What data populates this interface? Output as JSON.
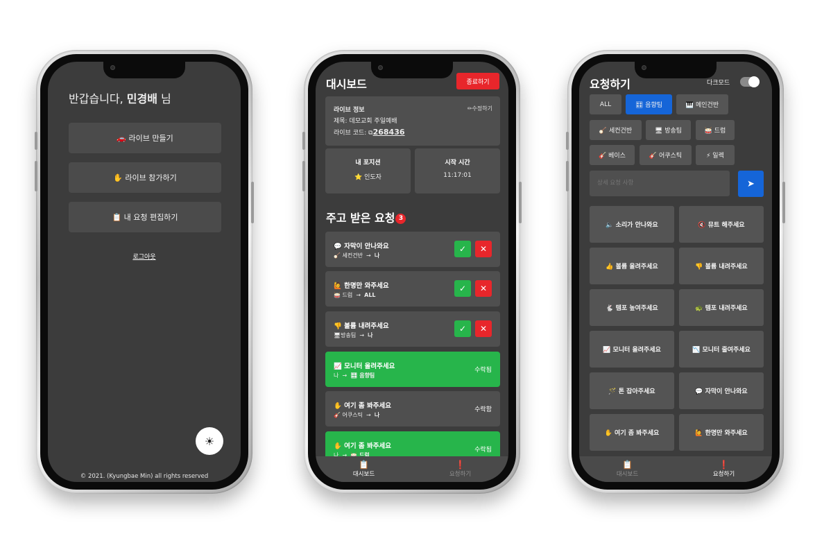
{
  "phone1": {
    "greeting_prefix": "반갑습니다, ",
    "user_name": "민경배",
    "greeting_suffix": " 님",
    "buttons": [
      {
        "label": "🚗 라이브 만들기"
      },
      {
        "label": "✋ 라이브 참가하기"
      },
      {
        "label": "📋 내 요청 편집하기"
      }
    ],
    "logout": "로그아웃",
    "theme_icon": "☀",
    "footer": "© 2021. (Kyungbae Min) all rights reserved"
  },
  "phone2": {
    "title": "대시보드",
    "end_button": "종료하기",
    "info": {
      "heading": "라이브 정보",
      "edit": "✏수정하기",
      "title_line": "제목: 데모교회 주일예배",
      "code_label": "라이브 코드: ",
      "code_icon": "⧉",
      "code": "268436"
    },
    "position": {
      "label": "내 포지션",
      "value": "⭐ 인도자"
    },
    "start_time": {
      "label": "시작 시간",
      "value": "11:17:01"
    },
    "requests_title": "주고 받은 요청",
    "requests_count": "3",
    "requests": [
      {
        "text": "💬 자막이 안나와요",
        "from": "🪕 세컨건반",
        "arrow": "→",
        "to": "나",
        "status": "",
        "state": "pending"
      },
      {
        "text": "🙋 한명만 와주세요",
        "from": "🥁 드럼",
        "arrow": "→",
        "to": "ALL",
        "status": "",
        "state": "pending"
      },
      {
        "text": "👎 볼륨 내려주세요",
        "from": "🖥방송팀",
        "arrow": "→",
        "to": "나",
        "status": "",
        "state": "pending"
      },
      {
        "text": "📈 모니터 올려주세요",
        "from": "나",
        "arrow": "→",
        "to": "🎛 음향팀",
        "status": "수락됨",
        "state": "accepted"
      },
      {
        "text": "✋ 여기 좀 봐주세요",
        "from": "🎸 어쿠스틱",
        "arrow": "→",
        "to": "나",
        "status": "수락함",
        "state": "accept-me"
      },
      {
        "text": "✋ 여기 좀 봐주세요",
        "from": "나",
        "arrow": "→",
        "to": "🥁 드럼",
        "status": "수락됨",
        "state": "accepted"
      }
    ],
    "accept_icon": "✓",
    "reject_icon": "✕",
    "tabs": [
      {
        "icon": "📋",
        "label": "대시보드"
      },
      {
        "icon": "❗",
        "label": "요청하기"
      }
    ]
  },
  "phone3": {
    "title": "요청하기",
    "dark_mode_label": "다크모드",
    "chips": [
      {
        "label": "ALL"
      },
      {
        "label": "🎛 음향팀"
      },
      {
        "label": "🎹 메인건반"
      },
      {
        "label": "🪕 세컨건반"
      },
      {
        "label": "🖥 방송팀"
      },
      {
        "label": "🥁 드럼"
      },
      {
        "label": "🎸 베이스"
      },
      {
        "label": "🎸 어쿠스틱"
      },
      {
        "label": "⚡ 일렉"
      }
    ],
    "input_placeholder": "상세 요청 사항",
    "send_icon": "➤",
    "quick_requests": [
      {
        "label": "🔈 소리가 안나와요"
      },
      {
        "label": "🔇 뮤트 해주세요"
      },
      {
        "label": "👍 볼륨 올려주세요"
      },
      {
        "label": "👎 볼륨 내려주세요"
      },
      {
        "label": "🐇 템포 높여주세요"
      },
      {
        "label": "🐢 템포 내려주세요"
      },
      {
        "label": "📈 모니터 올려주세요"
      },
      {
        "label": "📉 모니터 줄여주세요"
      },
      {
        "label": "🪄 톤 잡아주세요"
      },
      {
        "label": "💬 자막이 안나와요"
      },
      {
        "label": "✋ 여기 좀 봐주세요"
      },
      {
        "label": "🙋 한명만 와주세요"
      }
    ],
    "tabs": [
      {
        "icon": "📋",
        "label": "대시보드"
      },
      {
        "icon": "❗",
        "label": "요청하기"
      }
    ]
  }
}
